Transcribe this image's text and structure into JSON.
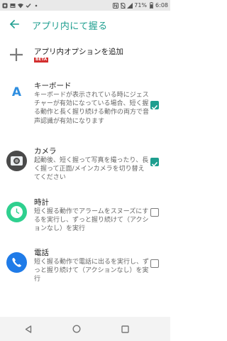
{
  "status_bar": {
    "battery_percent": "71%",
    "time": "6:08",
    "icons": [
      "app-icon",
      "image-icon",
      "wifi-icon",
      "check-icon",
      "dot-icon",
      "nfc-icon",
      "no-sim-icon",
      "signal-icon",
      "battery-icon"
    ]
  },
  "header": {
    "title": "アプリ内にて握る"
  },
  "add_option": {
    "label": "アプリ内オプションを追加",
    "badge": "BETA"
  },
  "items": [
    {
      "title": "キーボード",
      "desc": "キーボードが表示されている時にジェスチャーが有効になっている場合、短く握る動作と長く握り続ける動作の両方で音声認識が有効になります",
      "checked": true,
      "icon": "keyboard-icon"
    },
    {
      "title": "カメラ",
      "desc": "起動後、短く握って写真を撮ったり、長く握って正面/メインカメラを切り替えてください",
      "checked": true,
      "icon": "camera-icon"
    },
    {
      "title": "時計",
      "desc": "短く握る動作でアラームをスヌーズにするを実行し、ずっと握り続けて（アクションなし）を実行",
      "checked": false,
      "icon": "clock-icon"
    },
    {
      "title": "電話",
      "desc": "短く握る動作で電話に出るを実行し、ずっと握り続けて（アクションなし）を実行",
      "checked": false,
      "icon": "phone-icon"
    }
  ],
  "colors": {
    "accent": "#1e9e8f",
    "beta": "#d32f2f"
  }
}
